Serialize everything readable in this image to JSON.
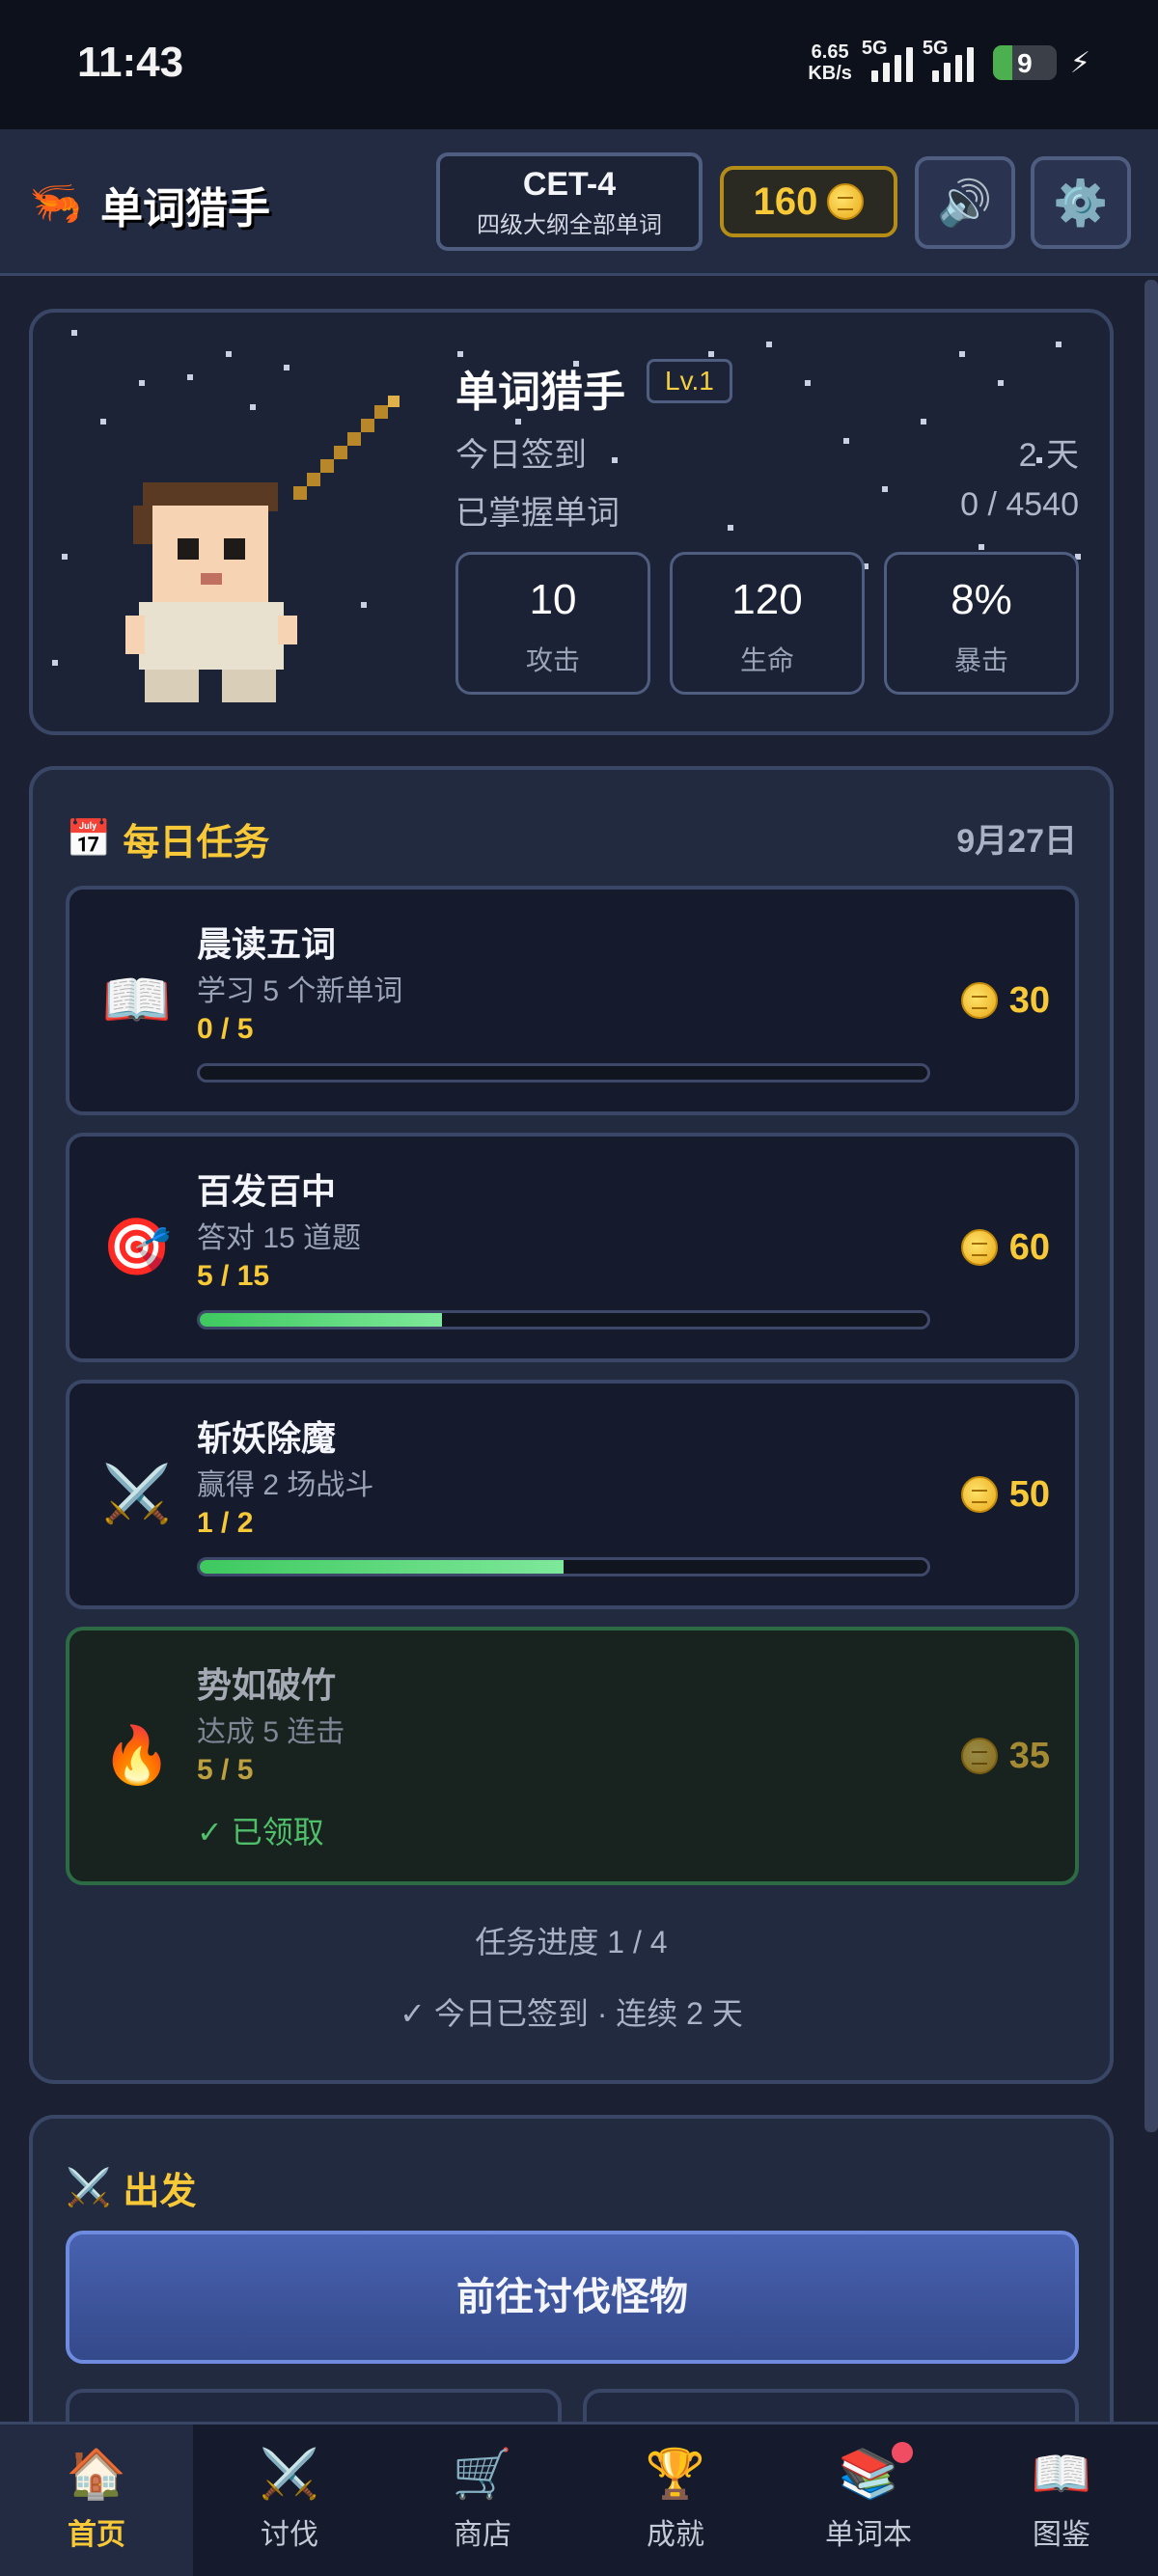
{
  "status_bar": {
    "time": "11:43",
    "net_speed_value": "6.65",
    "net_speed_unit": "KB/s",
    "signal_1": "5G",
    "signal_2": "5G",
    "battery": "9"
  },
  "header": {
    "app_icon": "shrimp-icon",
    "title": "单词猎手",
    "level_name": "CET-4",
    "level_desc": "四级大纲全部单词",
    "coins": "160",
    "sound_icon": "speaker-icon",
    "settings_icon": "gear-icon"
  },
  "hero": {
    "name": "单词猎手",
    "level": "Lv.1",
    "checkin_label": "今日签到",
    "checkin_value": "2 天",
    "mastered_label": "已掌握单词",
    "mastered_value": "0 / 4540",
    "stats": [
      {
        "value": "10",
        "label": "攻击"
      },
      {
        "value": "120",
        "label": "生命"
      },
      {
        "value": "8%",
        "label": "暴击"
      }
    ]
  },
  "daily_tasks": {
    "title": "每日任务",
    "icon": "calendar-icon",
    "date": "9月27日",
    "items": [
      {
        "icon": "book-icon",
        "emoji": "📖",
        "name": "晨读五词",
        "desc": "学习 5 个新单词",
        "progress": "0 / 5",
        "fraction": 0,
        "reward": "30",
        "claimed": false
      },
      {
        "icon": "target-icon",
        "emoji": "🎯",
        "name": "百发百中",
        "desc": "答对 15 道题",
        "progress": "5 / 15",
        "fraction": 0.333,
        "reward": "60",
        "claimed": false
      },
      {
        "icon": "crossed-swords-icon",
        "emoji": "⚔️",
        "name": "斩妖除魔",
        "desc": "赢得 2 场战斗",
        "progress": "1 / 2",
        "fraction": 0.5,
        "reward": "50",
        "claimed": false
      },
      {
        "icon": "fire-icon",
        "emoji": "🔥",
        "name": "势如破竹",
        "desc": "达成 5 连击",
        "progress": "5 / 5",
        "fraction": 1,
        "reward": "35",
        "claimed": true,
        "claimed_label": "✓ 已领取"
      }
    ],
    "summary": "任务进度 1 / 4",
    "checkin": "✓ 今日已签到 · 连续 2 天"
  },
  "depart": {
    "title": "出发",
    "icon": "crossed-swords-icon",
    "hunt_button": "前往讨伐怪物"
  },
  "bottom_nav": [
    {
      "icon": "house-icon",
      "emoji": "🏠",
      "label": "首页",
      "active": true
    },
    {
      "icon": "crossed-swords-icon",
      "emoji": "⚔️",
      "label": "讨伐",
      "active": false
    },
    {
      "icon": "cart-icon",
      "emoji": "🛒",
      "label": "商店",
      "active": false
    },
    {
      "icon": "trophy-icon",
      "emoji": "🏆",
      "label": "成就",
      "active": false
    },
    {
      "icon": "books-icon",
      "emoji": "📚",
      "label": "单词本",
      "active": false,
      "badge": true
    },
    {
      "icon": "open-book-icon",
      "emoji": "📖",
      "label": "图鉴",
      "active": false
    }
  ],
  "colors": {
    "accent_gold": "#f7c938",
    "progress_green": "#3ec95f",
    "panel_bg": "#222a40",
    "notification_red": "#f04d63"
  }
}
